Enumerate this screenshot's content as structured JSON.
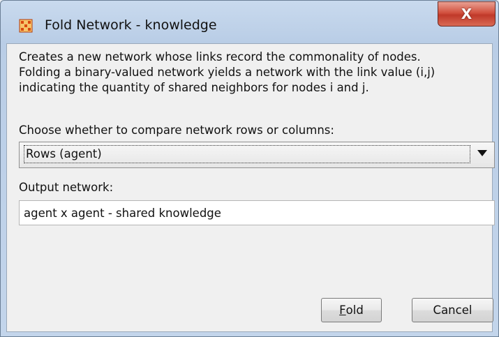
{
  "window": {
    "title": "Fold Network - knowledge",
    "close_label": "X"
  },
  "description": "Creates a new network whose links record the commonality of nodes.\nFolding a binary-valued network yields a network with the link value (i,j)\nindicating the quantity of shared neighbors for nodes i and j.",
  "compare": {
    "label": "Choose whether to compare network rows or columns:",
    "selected": "Rows (agent)"
  },
  "output": {
    "label": "Output network:",
    "value": "agent x agent - shared knowledge"
  },
  "buttons": {
    "fold_mnemonic": "F",
    "fold_rest": "old",
    "cancel": "Cancel"
  },
  "colors": {
    "app_icon": "#d9480f",
    "close_button": "#c0392a"
  },
  "icons": {
    "app": "network-grid-icon",
    "close": "close-icon",
    "dropdown": "chevron-down-icon"
  }
}
